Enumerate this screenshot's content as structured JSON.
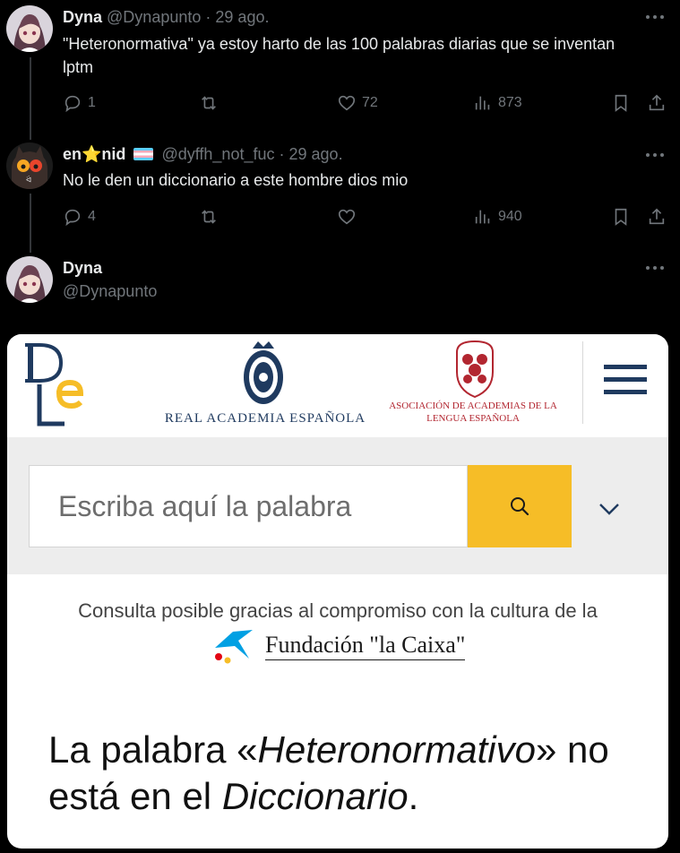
{
  "tweets": [
    {
      "name": "Dyna",
      "handle": "@Dynapunto",
      "dot": "·",
      "date": "29 ago.",
      "text": "\"Heteronormativa\" ya estoy harto de las 100 palabras diarias que se inventan lptm",
      "replies": "1",
      "reposts": "",
      "likes": "72",
      "views": "873"
    },
    {
      "name": "en⭐nid",
      "handle": "@dyffh_not_fuc",
      "dot": "·",
      "date": "29 ago.",
      "text": "No le den un diccionario a este hombre dios mio",
      "replies": "4",
      "reposts": "",
      "likes": "",
      "views": "940"
    },
    {
      "name": "Dyna",
      "handle": "@Dynapunto"
    }
  ],
  "icons": {
    "reply": "reply-icon",
    "repost": "repost-icon",
    "like": "heart-icon",
    "views": "views-icon",
    "bookmark": "bookmark-icon",
    "share": "share-icon",
    "more": "more-icon"
  },
  "rae": {
    "rae_name": "REAL ACADEMIA ESPAÑOLA",
    "asale_line1": "ASOCIACIÓN DE ACADEMIAS DE LA",
    "asale_line2": "LENGUA ESPAÑOLA",
    "search_placeholder": "Escriba aquí la palabra",
    "sponsor_text": "Consulta posible gracias al compromiso con la cultura de la",
    "sponsor_name": "Fundación \"la Caixa\"",
    "result_prefix": "La palabra «",
    "result_word": "Heteronormativo",
    "result_mid": "» no está en el ",
    "result_dict": "Diccionario",
    "result_end": ".",
    "colors": {
      "accent": "#f6bd27",
      "navy": "#1f3a5f",
      "red": "#b22630"
    }
  }
}
